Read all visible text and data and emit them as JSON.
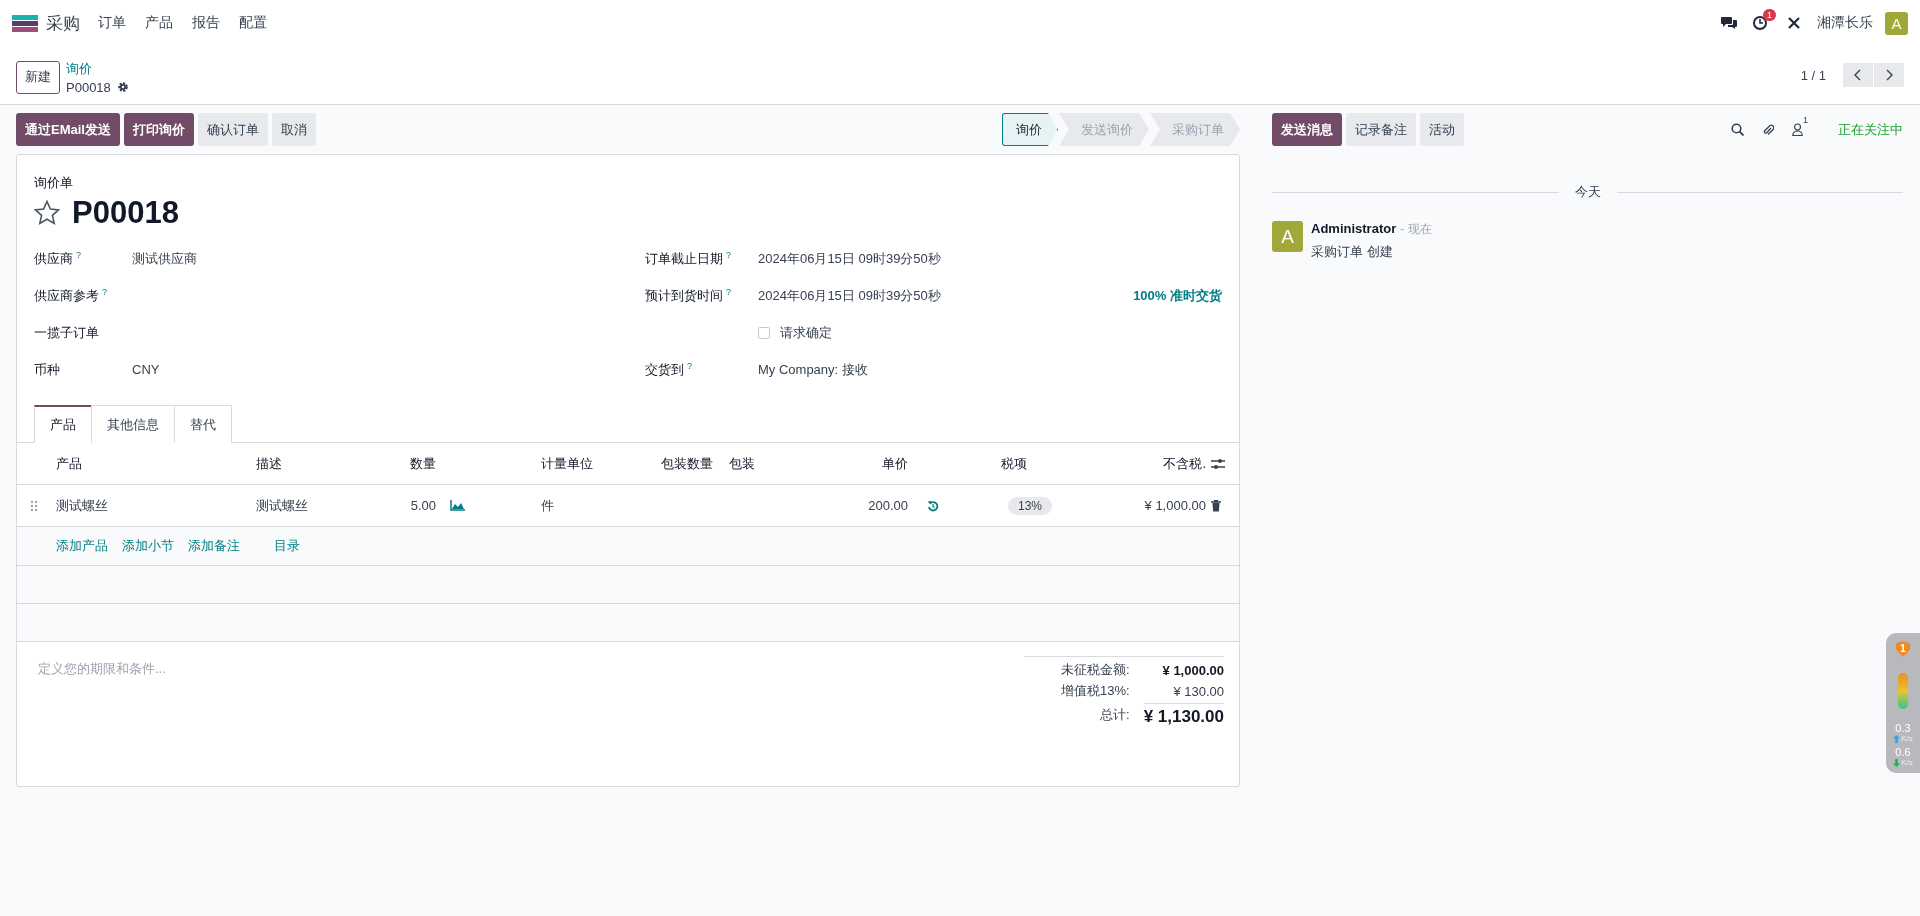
{
  "navbar": {
    "app": "采购",
    "menus": [
      "订单",
      "产品",
      "报告",
      "配置"
    ],
    "activity_count": "1",
    "company": "湘潭长乐",
    "avatar": "A"
  },
  "control_panel": {
    "new_button": "新建",
    "breadcrumb": "询价",
    "record": "P00018",
    "pager": "1 / 1"
  },
  "actions": {
    "buttons": [
      {
        "label": "通过EMail发送",
        "kind": "primary"
      },
      {
        "label": "打印询价",
        "kind": "primary"
      },
      {
        "label": "确认订单",
        "kind": "secondary"
      },
      {
        "label": "取消",
        "kind": "secondary"
      }
    ],
    "stages": [
      {
        "label": "询价",
        "selected": true
      },
      {
        "label": "发送询价",
        "selected": false
      },
      {
        "label": "采购订单",
        "selected": false
      }
    ]
  },
  "form": {
    "doc_type": "询价单",
    "name": "P00018",
    "starred": false,
    "left_fields": [
      {
        "label": "供应商",
        "help": "?",
        "value": "测试供应商"
      },
      {
        "label": "供应商参考",
        "help": "?"
      },
      {
        "label": "一揽子订单"
      },
      {
        "label": "币种",
        "value": "CNY"
      }
    ],
    "right_fields": [
      {
        "kind": "text",
        "label": "订单截止日期",
        "help": "?",
        "value": "2024年06月15日 09时39分50秒"
      },
      {
        "kind": "text",
        "label": "预计到货时间",
        "help": "?",
        "value": "2024年06月15日 09时39分50秒",
        "note": "100% 准时交货"
      },
      {
        "kind": "checkbox",
        "value": "请求确定",
        "checked": false
      },
      {
        "kind": "text",
        "label": "交货到",
        "help": "?",
        "value": "My Company: 接收"
      }
    ],
    "tabs": [
      {
        "label": "产品",
        "selected": true
      },
      {
        "label": "其他信息",
        "selected": false
      },
      {
        "label": "替代",
        "selected": false
      }
    ],
    "table": {
      "columns": [
        "产品",
        "描述",
        "数量",
        "计量单位",
        "包装数量",
        "包装",
        "单价",
        "税项",
        "不含税."
      ],
      "rows": [
        {
          "product": "测试螺丝",
          "description": "测试螺丝",
          "quantity": "5.00",
          "uom": "件",
          "price": "200.00",
          "tax": "13%",
          "subtotal": "¥ 1,000.00"
        }
      ]
    },
    "add_links": [
      "添加产品",
      "添加小节",
      "添加备注",
      "目录"
    ],
    "terms_placeholder": "定义您的期限和条件...",
    "totals": [
      {
        "kind": "untaxed",
        "label": "未征税金额:",
        "value": "¥ 1,000.00"
      },
      {
        "kind": "tax",
        "label": "增值税13%:",
        "value": "¥ 130.00"
      },
      {
        "kind": "total",
        "label": "总计:",
        "value": "¥ 1,130.00"
      }
    ]
  },
  "chatter": {
    "buttons": [
      {
        "label": "发送消息",
        "kind": "primary"
      },
      {
        "label": "记录备注",
        "kind": "secondary"
      },
      {
        "label": "活动",
        "kind": "secondary"
      }
    ],
    "followers_count": "1",
    "following": "正在关注中",
    "date_separator": "今天",
    "messages": [
      {
        "avatar": "A",
        "author": "Administrator",
        "time": "- 现在",
        "body": "采购订单 创建"
      }
    ]
  },
  "net_meter": {
    "badge": "1",
    "upload": "0.3",
    "upload_unit": "K/s",
    "download": "0.6",
    "download_unit": "K/s"
  }
}
